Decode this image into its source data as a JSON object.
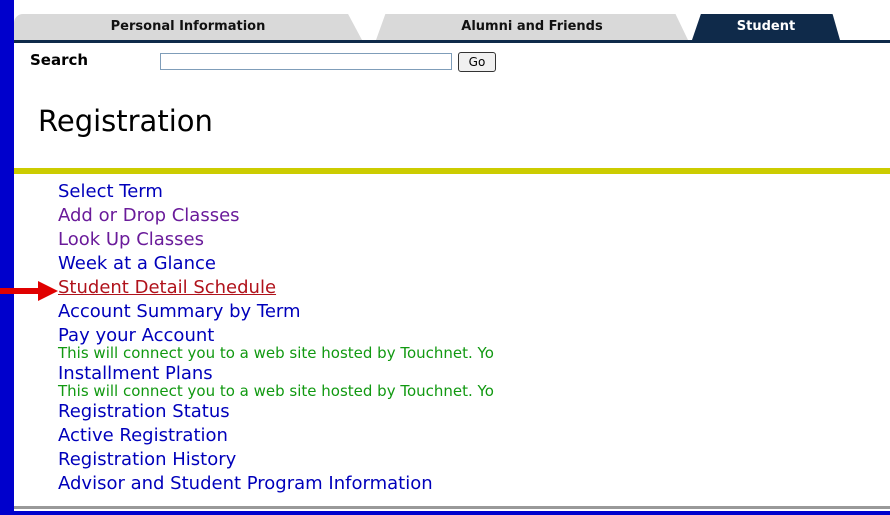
{
  "tabs": [
    {
      "label": "Personal Information",
      "active": false
    },
    {
      "label": "Alumni and Friends",
      "active": false
    },
    {
      "label": "Student",
      "active": true
    }
  ],
  "search": {
    "label": "Search",
    "value": "",
    "button_label": "Go"
  },
  "page_title": "Registration",
  "menu": [
    {
      "label": "Select Term",
      "color": "#0000bb"
    },
    {
      "label": "Add or Drop Classes",
      "color": "#6a1b9a"
    },
    {
      "label": "Look Up Classes",
      "color": "#6a1b9a"
    },
    {
      "label": "Week at a Glance",
      "color": "#0000bb"
    },
    {
      "label": "Student Detail Schedule",
      "color": "#b0121b",
      "highlighted": true
    },
    {
      "label": "Account Summary by Term",
      "color": "#0000bb"
    },
    {
      "label": "Pay your Account",
      "color": "#0000bb",
      "note": "This will connect you to a web site hosted by Touchnet. Yo"
    },
    {
      "label": "Installment Plans",
      "color": "#0000bb",
      "note": "This will connect you to a web site hosted by Touchnet. Yo"
    },
    {
      "label": "Registration Status",
      "color": "#0000bb"
    },
    {
      "label": "Active Registration",
      "color": "#0000bb"
    },
    {
      "label": "Registration History",
      "color": "#0000bb"
    },
    {
      "label": "Advisor and Student Program Information",
      "color": "#0000bb"
    }
  ],
  "colors": {
    "background": "#0000cc",
    "tab_active": "#0f2a4a",
    "accent_rule": "#cccc00",
    "note_text": "#119911",
    "arrow": "#e00000"
  },
  "icons": {
    "pointer": "red-arrow-icon"
  }
}
